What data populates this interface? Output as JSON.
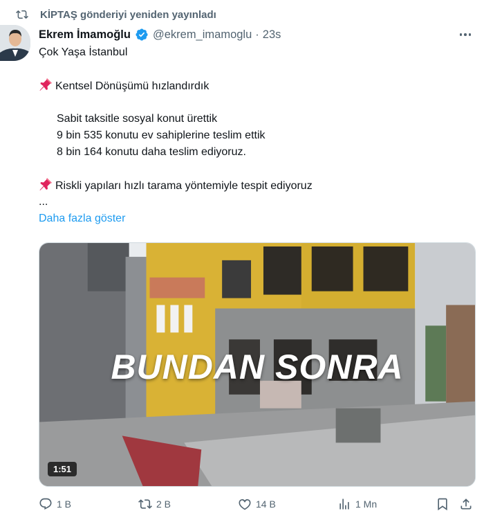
{
  "repost_banner": {
    "icon": "repost-icon",
    "text": "KİPTAŞ gönderiyi yeniden yayınladı"
  },
  "author": {
    "name": "Ekrem İmamoğlu",
    "verified": true,
    "handle": "@ekrem_imamoglu",
    "separator": "·",
    "time": "23s"
  },
  "tweet": {
    "lines": {
      "l1": "Çok Yaşa İstanbul",
      "l2": "Kentsel Dönüşümü hızlandırdık",
      "l3": "Sabit taksitle sosyal konut ürettik",
      "l4": "9 bin 535 konutu ev sahiplerine teslim ettik",
      "l5": "8 bin 164 konutu daha teslim ediyoruz.",
      "l6": "Riskli yapıları hızlı tarama yöntemiyle tespit ediyoruz",
      "l7": "..."
    },
    "show_more": "Daha fazla göster"
  },
  "media": {
    "overlay_text": "BUNDAN SONRA",
    "duration": "1:51"
  },
  "actions": {
    "replies": "1 B",
    "reposts": "2 B",
    "likes": "14 B",
    "views": "1 Mn"
  },
  "colors": {
    "link": "#1d9bf0",
    "verified": "#1d9bf0",
    "muted": "#536471",
    "pin": "#e0245e"
  }
}
